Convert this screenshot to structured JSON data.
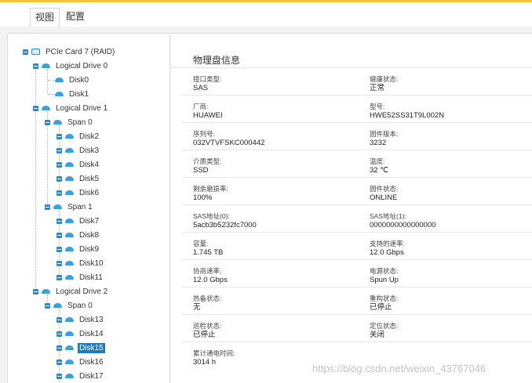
{
  "tabs": [
    {
      "label": "视图"
    },
    {
      "label": "配置"
    }
  ],
  "tree": {
    "root": "PCIe Card 7 (RAID)",
    "ld0": "Logical Drive 0",
    "ld1": "Logical Drive 1",
    "ld2": "Logical Drive 2",
    "span": "Span 0",
    "span1": "Span 1",
    "disks": {
      "d0": "Disk0",
      "d1": "Disk1",
      "d2": "Disk2",
      "d3": "Disk3",
      "d4": "Disk4",
      "d5": "Disk5",
      "d6": "Disk6",
      "d7": "Disk7",
      "d8": "Disk8",
      "d9": "Disk9",
      "d10": "Disk10",
      "d11": "Disk11",
      "d13": "Disk13",
      "d14": "Disk14",
      "d15": "Disk15",
      "d16": "Disk16",
      "d17": "Disk17"
    },
    "selected": "Disk15"
  },
  "details": {
    "title": "物理盘信息",
    "fields": [
      {
        "label": "接口类型:",
        "value": "SAS"
      },
      {
        "label": "健康状态:",
        "value": "正常"
      },
      {
        "label": "厂商:",
        "value": "HUAWEI"
      },
      {
        "label": "型号:",
        "value": "HWE52SS31T9L002N"
      },
      {
        "label": "序列号:",
        "value": "032VTVFSKC000442"
      },
      {
        "label": "固件版本:",
        "value": "3232"
      },
      {
        "label": "介质类型:",
        "value": "SSD"
      },
      {
        "label": "温度:",
        "value": "32 ℃"
      },
      {
        "label": "剩余磨损率:",
        "value": "100%"
      },
      {
        "label": "固件状态:",
        "value": "ONLINE"
      },
      {
        "label": "SAS地址(0):",
        "value": "5acb3b5232fc7000"
      },
      {
        "label": "SAS地址(1):",
        "value": "0000000000000000"
      },
      {
        "label": "容量:",
        "value": "1.745 TB"
      },
      {
        "label": "支持的速率:",
        "value": "12.0 Gbps"
      },
      {
        "label": "协商速率:",
        "value": "12.0 Gbps"
      },
      {
        "label": "电源状态:",
        "value": "Spun Up"
      },
      {
        "label": "热备状态:",
        "value": "无"
      },
      {
        "label": "重构状态:",
        "value": "已停止"
      },
      {
        "label": "巡检状态:",
        "value": "已停止"
      },
      {
        "label": "定位状态:",
        "value": "关闭"
      },
      {
        "label": "累计通电时间:",
        "value": "3014 h"
      }
    ]
  },
  "watermark": "https://blog.csdn.net/weixin_43767046",
  "colors": {
    "accent": "#1b8fd7",
    "selected": "#1d7bbf",
    "top_bar": "#f5c33b"
  }
}
